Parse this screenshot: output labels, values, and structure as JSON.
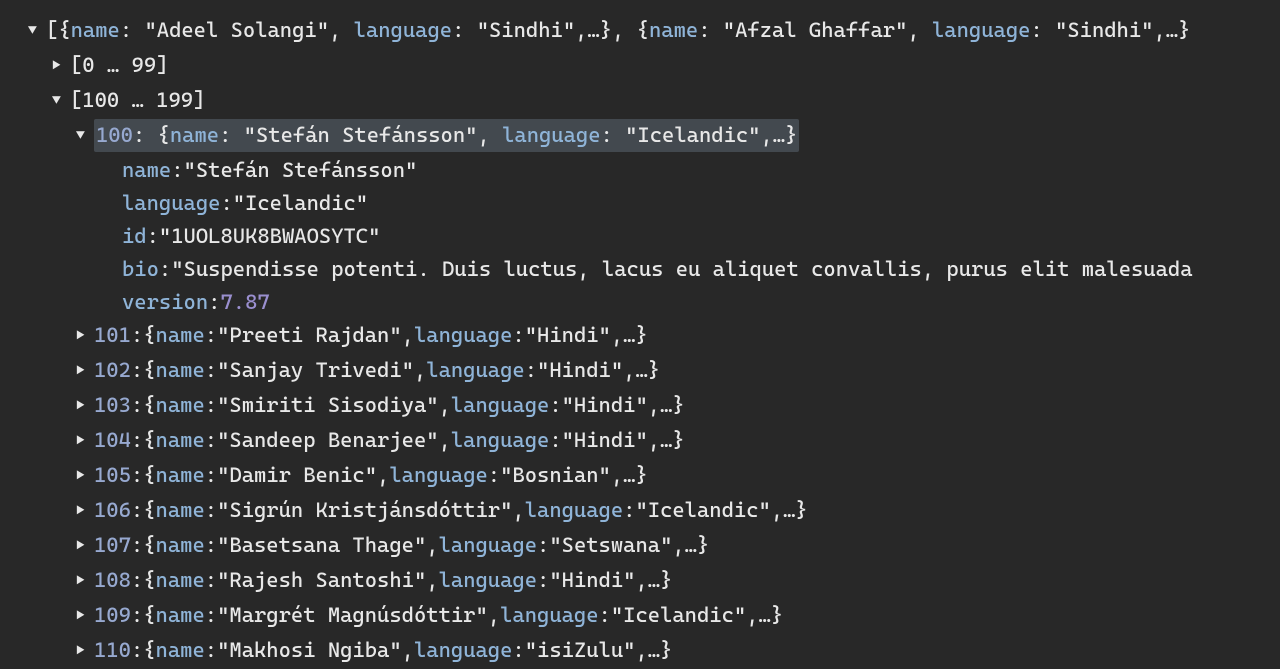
{
  "root_summary": {
    "open_bracket": "[",
    "brace_open": "{",
    "k_name": "name",
    "v_name1": "\"Adeel Solangi\"",
    "k_lang": "language",
    "v_lang1": "\"Sindhi\"",
    "ellip": ",…}",
    "comma_sep": ", ",
    "v_name2": "\"Afzal Ghaffar\"",
    "v_lang2": "\"Sindhi\"",
    "tail": ",…}"
  },
  "group_0_99": "[0 … 99]",
  "group_100_199": "[100 … 199]",
  "expanded": {
    "index": "100",
    "summary": {
      "name": "\"Stefán Stefánsson\"",
      "language": "\"Icelandic\""
    },
    "fields": {
      "name_key": "name",
      "name_val": "\"Stefán Stefánsson\"",
      "language_key": "language",
      "language_val": "\"Icelandic\"",
      "id_key": "id",
      "id_val": "\"1UOL8UK8BWAOSYTC\"",
      "bio_key": "bio",
      "bio_val": "\"Suspendisse potenti. Duis luctus, lacus eu aliquet convallis, purus elit malesuada",
      "version_key": "version",
      "version_val": "7.87"
    }
  },
  "collapsed": [
    {
      "index": "101",
      "name": "\"Preeti Rajdan\"",
      "language": "\"Hindi\""
    },
    {
      "index": "102",
      "name": "\"Sanjay Trivedi\"",
      "language": "\"Hindi\""
    },
    {
      "index": "103",
      "name": "\"Smiriti Sisodiya\"",
      "language": "\"Hindi\""
    },
    {
      "index": "104",
      "name": "\"Sandeep Benarjee\"",
      "language": "\"Hindi\""
    },
    {
      "index": "105",
      "name": "\"Damir Benic\"",
      "language": "\"Bosnian\""
    },
    {
      "index": "106",
      "name": "\"Sigrún Kristjánsdóttir\"",
      "language": "\"Icelandic\""
    },
    {
      "index": "107",
      "name": "\"Basetsana Thage\"",
      "language": "\"Setswana\""
    },
    {
      "index": "108",
      "name": "\"Rajesh Santoshi\"",
      "language": "\"Hindi\""
    },
    {
      "index": "109",
      "name": "\"Margrét Magnúsdóttir\"",
      "language": "\"Icelandic\""
    },
    {
      "index": "110",
      "name": "\"Makhosi Ngiba\"",
      "language": "\"isiZulu\""
    }
  ],
  "labels": {
    "name": "name",
    "language": "language",
    "colon_sp": ": ",
    "comma_ellip_brace": ",…}",
    "brace_open": "{",
    "brace_close": "}"
  }
}
